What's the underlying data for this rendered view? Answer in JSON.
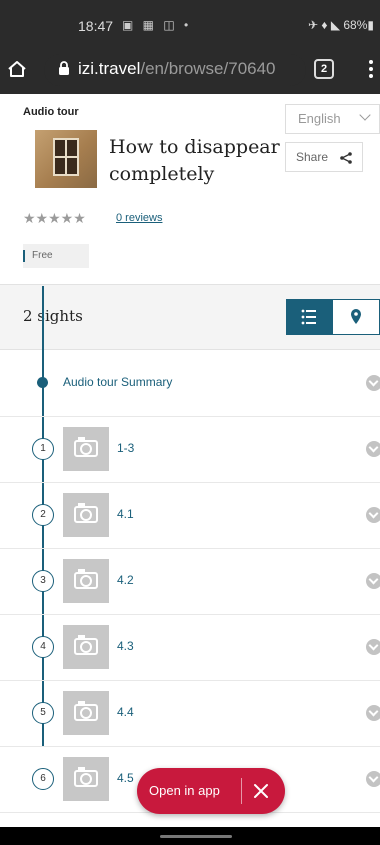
{
  "status_bar": {
    "time": "18:47",
    "left_icons": "▣ ▦ ◫ •",
    "right_icons": "✈ ♦ ◣ 68%▮"
  },
  "browser": {
    "url_host": "izi.travel",
    "url_path": "/en/browse/70640",
    "tab_count": "2"
  },
  "tour": {
    "type_label": "Audio tour",
    "title": "How to disappear completely",
    "language": "English",
    "share_label": "Share",
    "stars": "★★★★★",
    "reviews_label": "0 reviews",
    "price_label": "Free"
  },
  "sights": {
    "count_label": "2 sights",
    "view": "list"
  },
  "items": [
    {
      "label": "Audio tour Summary",
      "number": ""
    },
    {
      "label": "1-3",
      "number": "1"
    },
    {
      "label": "4.1",
      "number": "2"
    },
    {
      "label": "4.2",
      "number": "3"
    },
    {
      "label": "4.3",
      "number": "4"
    },
    {
      "label": "4.4",
      "number": "5"
    },
    {
      "label": "4.5",
      "number": "6"
    }
  ],
  "open_in_app": {
    "label": "Open in app"
  },
  "colors": {
    "accent": "#1a5f7a",
    "cta": "#c8193d"
  }
}
